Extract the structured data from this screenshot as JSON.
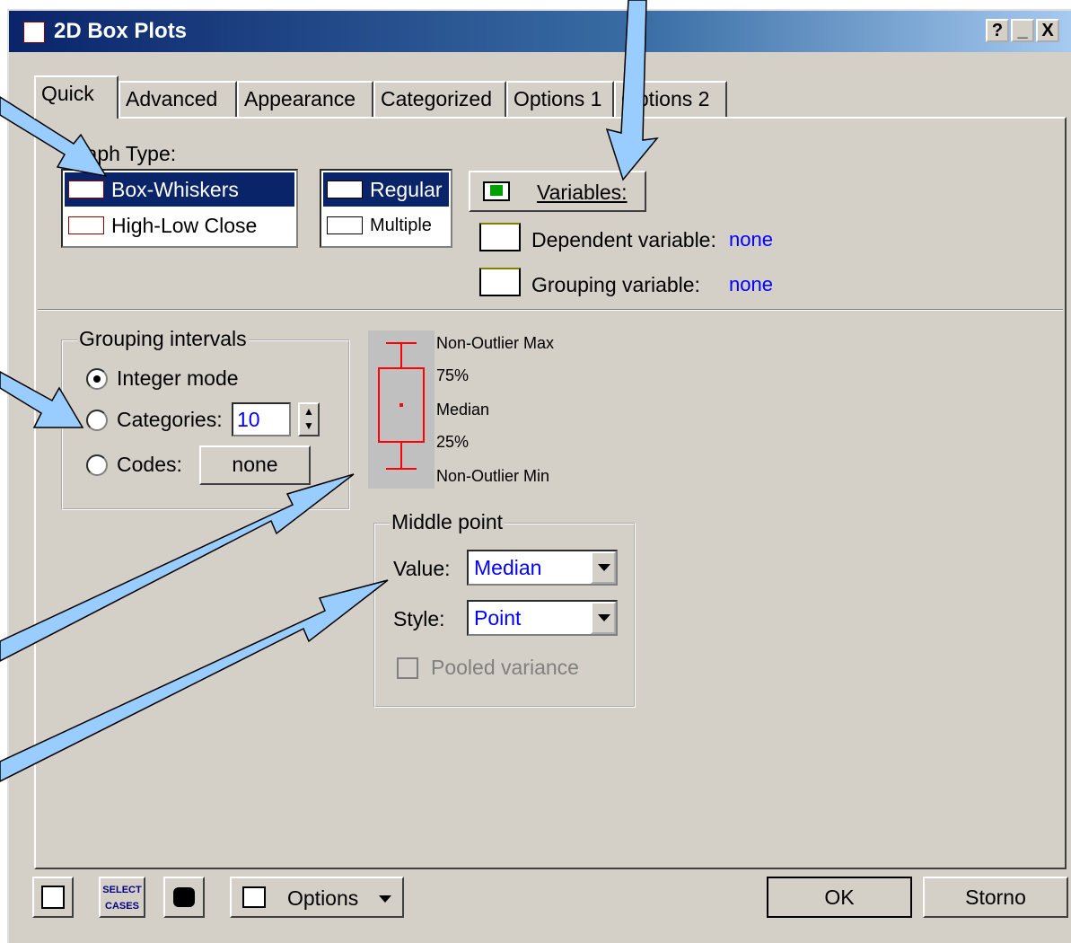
{
  "window": {
    "title": "2D Box Plots",
    "controls": {
      "help": "?",
      "minimize": "_",
      "close": "X"
    }
  },
  "tabs": [
    "Quick",
    "Advanced",
    "Appearance",
    "Categorized",
    "Options 1",
    "Options 2"
  ],
  "graph_type": {
    "label": "Graph Type:",
    "types": [
      "Box-Whiskers",
      "High-Low Close"
    ],
    "modes": [
      "Regular",
      "Multiple"
    ]
  },
  "variables": {
    "button_label": "Variables:",
    "dependent_label": "Dependent variable:",
    "dependent_value": "none",
    "grouping_label": "Grouping variable:",
    "grouping_value": "none"
  },
  "grouping_intervals": {
    "title": "Grouping intervals",
    "integer_mode": "Integer mode",
    "categories_label": "Categories:",
    "categories_value": "10",
    "codes_label": "Codes:",
    "codes_button": "none"
  },
  "box_legend": {
    "max": "Non-Outlier Max",
    "q75": "75%",
    "median": "Median",
    "q25": "25%",
    "min": "Non-Outlier Min"
  },
  "middle_point": {
    "title": "Middle point",
    "value_label": "Value:",
    "value_selected": "Median",
    "style_label": "Style:",
    "style_selected": "Point",
    "pooled_variance": "Pooled variance"
  },
  "bottom": {
    "select_cases": "SELECT\nCASES",
    "options_label": "Options",
    "ok_label": "OK",
    "cancel_label": "Storno"
  },
  "colors": {
    "arrow": "#99ccff",
    "title_start": "#0a246a",
    "box": "#ff0000",
    "value_text": "#0000ff"
  }
}
